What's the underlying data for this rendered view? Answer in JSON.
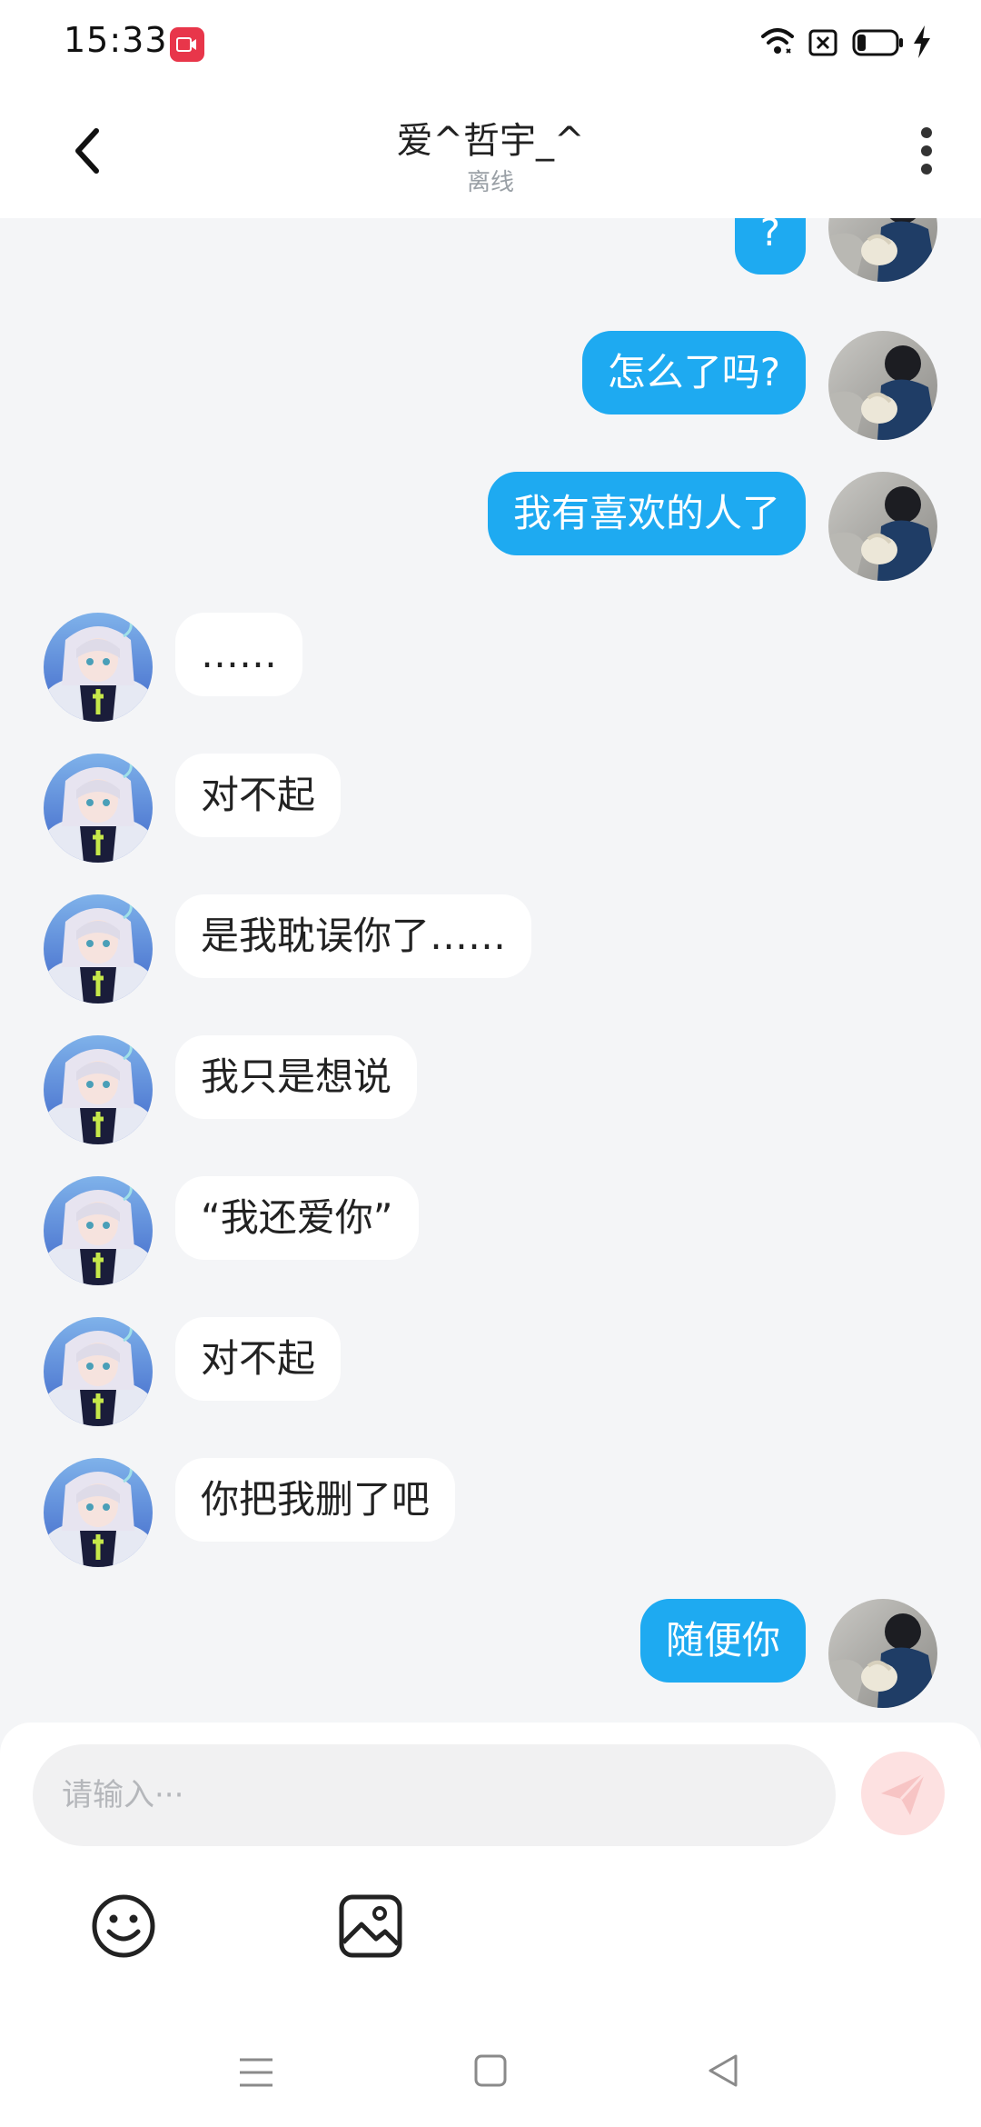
{
  "status_bar": {
    "time": "15:33",
    "icons": [
      "screen-record-icon",
      "wifi-icon",
      "sim-off-icon",
      "battery-icon",
      "charging-icon"
    ]
  },
  "header": {
    "title": "爱^哲宇_^",
    "status": "离线",
    "icons": [
      "back-arrow-icon",
      "more-vertical-icon"
    ]
  },
  "messages": [
    {
      "side": "mine",
      "text": "?"
    },
    {
      "side": "mine",
      "text": "怎么了吗?"
    },
    {
      "side": "mine",
      "text": "我有喜欢的人了"
    },
    {
      "side": "theirs",
      "text": "……"
    },
    {
      "side": "theirs",
      "text": "对不起"
    },
    {
      "side": "theirs",
      "text": "是我耽误你了……"
    },
    {
      "side": "theirs",
      "text": "我只是想说"
    },
    {
      "side": "theirs",
      "text": "“我还爱你”"
    },
    {
      "side": "theirs",
      "text": "对不起"
    },
    {
      "side": "theirs",
      "text": "你把我删了吧"
    },
    {
      "side": "mine",
      "text": "随便你"
    }
  ],
  "composer": {
    "placeholder": "请输入···",
    "value": "",
    "icons": [
      "send-icon",
      "emoji-icon",
      "image-icon"
    ]
  },
  "nav_bar": {
    "icons": [
      "menu-icon",
      "home-icon",
      "back-triangle-icon"
    ]
  },
  "colors": {
    "my_bubble": "#1eaaf1",
    "their_bubble": "#ffffff",
    "background": "#f4f5f7",
    "send_button": "#fde1e1",
    "record_badge": "#e8364a"
  }
}
